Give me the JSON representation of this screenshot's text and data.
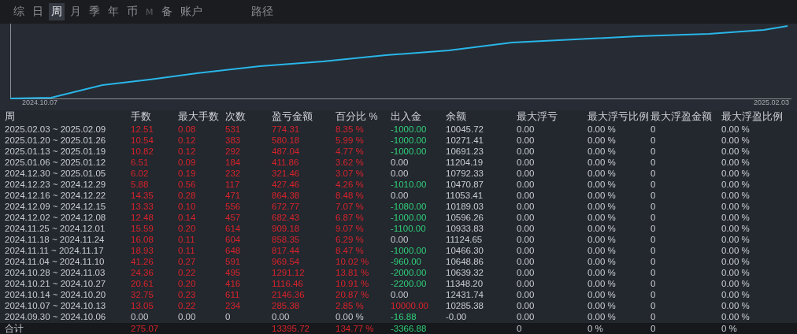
{
  "tabs": [
    {
      "label": "综",
      "selected": false,
      "disabled": false
    },
    {
      "label": "日",
      "selected": false,
      "disabled": false
    },
    {
      "label": "周",
      "selected": true,
      "disabled": false
    },
    {
      "label": "月",
      "selected": false,
      "disabled": false
    },
    {
      "label": "季",
      "selected": false,
      "disabled": false
    },
    {
      "label": "年",
      "selected": false,
      "disabled": false
    },
    {
      "label": "币",
      "selected": false,
      "disabled": false
    },
    {
      "label": "M",
      "selected": false,
      "disabled": true
    },
    {
      "label": "备",
      "selected": false,
      "disabled": false
    },
    {
      "label": "账户",
      "selected": false,
      "disabled": false
    },
    {
      "label": "路径",
      "selected": false,
      "disabled": false
    }
  ],
  "chart": {
    "start_label": "2024.10.07",
    "end_label": "2025.02.03"
  },
  "table": {
    "columns": [
      "周",
      "手数",
      "最大手数",
      "次数",
      "盈亏金额",
      "百分比 %",
      "出入金",
      "余额",
      "最大浮亏",
      "最大浮亏比例",
      "最大浮盈金额",
      "最大浮盈比例"
    ],
    "rows": [
      {
        "active": true,
        "withdrawal": true,
        "deposit": false,
        "cells": [
          "2025.02.03 ~ 2025.02.09",
          "12.51",
          "0.08",
          "531",
          "774.31",
          "8.35 %",
          "-1000.00",
          "10045.72",
          "0.00",
          "0.00 %",
          "0",
          "0.00 %"
        ]
      },
      {
        "active": true,
        "withdrawal": true,
        "deposit": false,
        "cells": [
          "2025.01.20 ~ 2025.01.26",
          "10.54",
          "0.12",
          "383",
          "580.18",
          "5.99 %",
          "-1000.00",
          "10271.41",
          "0.00",
          "0.00 %",
          "0",
          "0.00 %"
        ]
      },
      {
        "active": true,
        "withdrawal": true,
        "deposit": false,
        "cells": [
          "2025.01.13 ~ 2025.01.19",
          "10.82",
          "0.12",
          "292",
          "487.04",
          "4.77 %",
          "-1000.00",
          "10691.23",
          "0.00",
          "0.00 %",
          "0",
          "0.00 %"
        ]
      },
      {
        "active": true,
        "withdrawal": false,
        "deposit": false,
        "cells": [
          "2025.01.06 ~ 2025.01.12",
          "6.51",
          "0.09",
          "184",
          "411.86",
          "3.62 %",
          "0.00",
          "11204.19",
          "0.00",
          "0.00 %",
          "0",
          "0.00 %"
        ]
      },
      {
        "active": true,
        "withdrawal": false,
        "deposit": false,
        "cells": [
          "2024.12.30 ~ 2025.01.05",
          "6.02",
          "0.19",
          "232",
          "321.46",
          "3.07 %",
          "0.00",
          "10792.33",
          "0.00",
          "0.00 %",
          "0",
          "0.00 %"
        ]
      },
      {
        "active": true,
        "withdrawal": true,
        "deposit": false,
        "cells": [
          "2024.12.23 ~ 2024.12.29",
          "5.88",
          "0.56",
          "117",
          "427.46",
          "4.26 %",
          "-1010.00",
          "10470.87",
          "0.00",
          "0.00 %",
          "0",
          "0.00 %"
        ]
      },
      {
        "active": true,
        "withdrawal": false,
        "deposit": false,
        "cells": [
          "2024.12.16 ~ 2024.12.22",
          "14.35",
          "0.28",
          "471",
          "864.38",
          "8.48 %",
          "0.00",
          "11053.41",
          "0.00",
          "0.00 %",
          "0",
          "0.00 %"
        ]
      },
      {
        "active": true,
        "withdrawal": true,
        "deposit": false,
        "cells": [
          "2024.12.09 ~ 2024.12.15",
          "13.33",
          "0.10",
          "556",
          "672.77",
          "7.07 %",
          "-1080.00",
          "10189.03",
          "0.00",
          "0.00 %",
          "0",
          "0.00 %"
        ]
      },
      {
        "active": true,
        "withdrawal": true,
        "deposit": false,
        "cells": [
          "2024.12.02 ~ 2024.12.08",
          "12.48",
          "0.14",
          "457",
          "682.43",
          "6.87 %",
          "-1000.00",
          "10596.26",
          "0.00",
          "0.00 %",
          "0",
          "0.00 %"
        ]
      },
      {
        "active": true,
        "withdrawal": true,
        "deposit": false,
        "cells": [
          "2024.11.25 ~ 2024.12.01",
          "15.59",
          "0.20",
          "614",
          "909.18",
          "9.07 %",
          "-1100.00",
          "10933.83",
          "0.00",
          "0.00 %",
          "0",
          "0.00 %"
        ]
      },
      {
        "active": true,
        "withdrawal": false,
        "deposit": false,
        "cells": [
          "2024.11.18 ~ 2024.11.24",
          "16.08",
          "0.11",
          "604",
          "858.35",
          "6.29 %",
          "0.00",
          "11124.65",
          "0.00",
          "0.00 %",
          "0",
          "0.00 %"
        ]
      },
      {
        "active": true,
        "withdrawal": true,
        "deposit": false,
        "cells": [
          "2024.11.11 ~ 2024.11.17",
          "18.93",
          "0.11",
          "648",
          "817.44",
          "8.47 %",
          "-1000.00",
          "10466.30",
          "0.00",
          "0.00 %",
          "0",
          "0.00 %"
        ]
      },
      {
        "active": true,
        "withdrawal": true,
        "deposit": false,
        "cells": [
          "2024.11.04 ~ 2024.11.10",
          "41.26",
          "0.27",
          "591",
          "969.54",
          "10.02 %",
          "-960.00",
          "10648.86",
          "0.00",
          "0.00 %",
          "0",
          "0.00 %"
        ]
      },
      {
        "active": true,
        "withdrawal": true,
        "deposit": false,
        "cells": [
          "2024.10.28 ~ 2024.11.03",
          "24.36",
          "0.22",
          "495",
          "1291.12",
          "13.81 %",
          "-2000.00",
          "10639.32",
          "0.00",
          "0.00 %",
          "0",
          "0.00 %"
        ]
      },
      {
        "active": true,
        "withdrawal": true,
        "deposit": false,
        "cells": [
          "2024.10.21 ~ 2024.10.27",
          "20.61",
          "0.20",
          "416",
          "1116.46",
          "10.91 %",
          "-2200.00",
          "11348.20",
          "0.00",
          "0.00 %",
          "0",
          "0.00 %"
        ]
      },
      {
        "active": true,
        "withdrawal": false,
        "deposit": false,
        "cells": [
          "2024.10.14 ~ 2024.10.20",
          "32.75",
          "0.23",
          "611",
          "2146.36",
          "20.87 %",
          "0.00",
          "12431.74",
          "0.00",
          "0.00 %",
          "0",
          "0.00 %"
        ]
      },
      {
        "active": true,
        "withdrawal": false,
        "deposit": true,
        "cells": [
          "2024.10.07 ~ 2024.10.13",
          "13.05",
          "0.22",
          "234",
          "285.38",
          "2.85 %",
          "10000.00",
          "10285.38",
          "0.00",
          "0.00 %",
          "0",
          "0.00 %"
        ]
      },
      {
        "active": false,
        "withdrawal": true,
        "deposit": false,
        "cells": [
          "2024.09.30 ~ 2024.10.06",
          "0.00",
          "0.00",
          "0",
          "0.00",
          "0.00 %",
          "-16.88",
          "-0.00",
          "0.00",
          "0.00 %",
          "0",
          "0.00 %"
        ]
      }
    ],
    "total": {
      "active": true,
      "withdrawal": true,
      "deposit": false,
      "cells": [
        "合计",
        "275.07",
        "",
        "",
        "13395.72",
        "134.77 %",
        "-3366.88",
        "",
        "0",
        "0 %",
        "0",
        "0 %"
      ]
    }
  }
}
